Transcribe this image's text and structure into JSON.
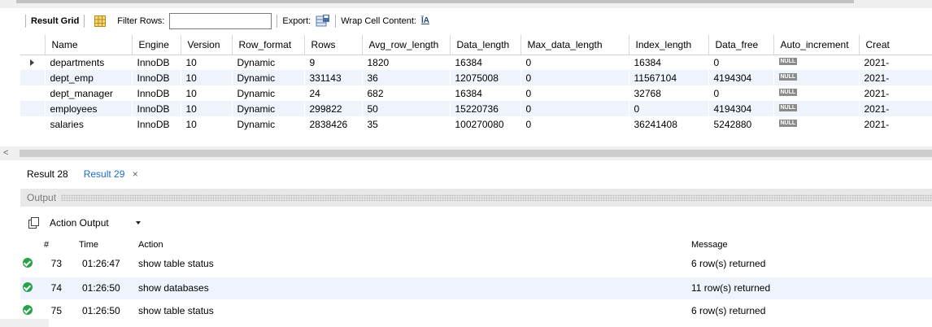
{
  "toolbar": {
    "result_grid": "Result Grid",
    "filter_rows": "Filter Rows:",
    "filter_value": "",
    "export": "Export:",
    "wrap_cell": "Wrap Cell Content:",
    "wrap_icon": "ĪA"
  },
  "grid": {
    "columns": [
      "Name",
      "Engine",
      "Version",
      "Row_format",
      "Rows",
      "Avg_row_length",
      "Data_length",
      "Max_data_length",
      "Index_length",
      "Data_free",
      "Auto_increment",
      "Creat"
    ],
    "null_label": "NULL",
    "rows": [
      {
        "selected": true,
        "cells": [
          "departments",
          "InnoDB",
          "10",
          "Dynamic",
          "9",
          "1820",
          "16384",
          "0",
          "16384",
          "0",
          "NULL",
          "2021-"
        ]
      },
      {
        "selected": false,
        "cells": [
          "dept_emp",
          "InnoDB",
          "10",
          "Dynamic",
          "331143",
          "36",
          "12075008",
          "0",
          "11567104",
          "4194304",
          "NULL",
          "2021-"
        ]
      },
      {
        "selected": false,
        "cells": [
          "dept_manager",
          "InnoDB",
          "10",
          "Dynamic",
          "24",
          "682",
          "16384",
          "0",
          "32768",
          "0",
          "NULL",
          "2021-"
        ]
      },
      {
        "selected": false,
        "cells": [
          "employees",
          "InnoDB",
          "10",
          "Dynamic",
          "299822",
          "50",
          "15220736",
          "0",
          "0",
          "4194304",
          "NULL",
          "2021-"
        ]
      },
      {
        "selected": false,
        "cells": [
          "salaries",
          "InnoDB",
          "10",
          "Dynamic",
          "2838426",
          "35",
          "100270080",
          "0",
          "36241408",
          "5242880",
          "NULL",
          "2021-"
        ]
      }
    ]
  },
  "result_tabs": [
    {
      "label": "Result 28",
      "active": false
    },
    {
      "label": "Result 29",
      "active": true,
      "close": "×"
    }
  ],
  "output": {
    "header": "Output",
    "selector": "Action Output",
    "columns": {
      "num": "#",
      "time": "Time",
      "action": "Action",
      "message": "Message"
    },
    "rows": [
      {
        "num": "73",
        "time": "01:26:47",
        "action": "show table status",
        "message": "6 row(s) returned",
        "status": "ok"
      },
      {
        "num": "74",
        "time": "01:26:50",
        "action": "show databases",
        "message": "11 row(s) returned",
        "status": "ok"
      },
      {
        "num": "75",
        "time": "01:26:50",
        "action": "show table status",
        "message": "6 row(s) returned",
        "status": "ok"
      }
    ]
  },
  "colors": {
    "active_tab": "#1b6ac9",
    "row_stripe": "#eef3fc",
    "ok_status": "#27a24a"
  },
  "icons": {
    "grid_view": "grid-view-icon",
    "export": "export-icon",
    "wrap": "wrap-text-icon",
    "copy": "copy-icon",
    "status": "check-circle-icon",
    "row_selector": "row-arrow-icon"
  }
}
